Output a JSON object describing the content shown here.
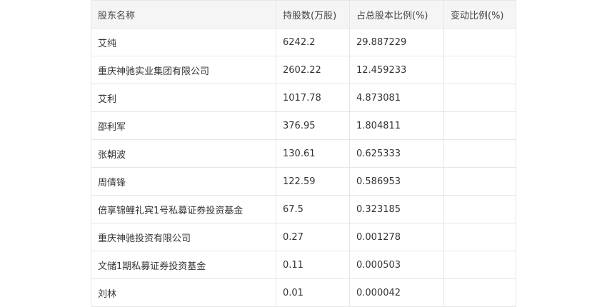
{
  "table": {
    "headers": [
      "股东名称",
      "持股数(万股)",
      "占总股本比例(%)",
      "变动比例(%)"
    ],
    "rows": [
      [
        "艾纯",
        "6242.2",
        "29.887229",
        ""
      ],
      [
        "重庆神驰实业集团有限公司",
        "2602.22",
        "12.459233",
        ""
      ],
      [
        "艾利",
        "1017.78",
        "4.873081",
        ""
      ],
      [
        "邵利军",
        "376.95",
        "1.804811",
        ""
      ],
      [
        "张朝波",
        "130.61",
        "0.625333",
        ""
      ],
      [
        "周倩锋",
        "122.59",
        "0.586953",
        ""
      ],
      [
        "倍享锦鲤礼宾1号私募证券投资基金",
        "67.5",
        "0.323185",
        ""
      ],
      [
        "重庆神驰投资有限公司",
        "0.27",
        "0.001278",
        ""
      ],
      [
        "文储1期私募证券投资基金",
        "0.11",
        "0.000503",
        ""
      ],
      [
        "刘林",
        "0.01",
        "0.000042",
        ""
      ]
    ]
  }
}
